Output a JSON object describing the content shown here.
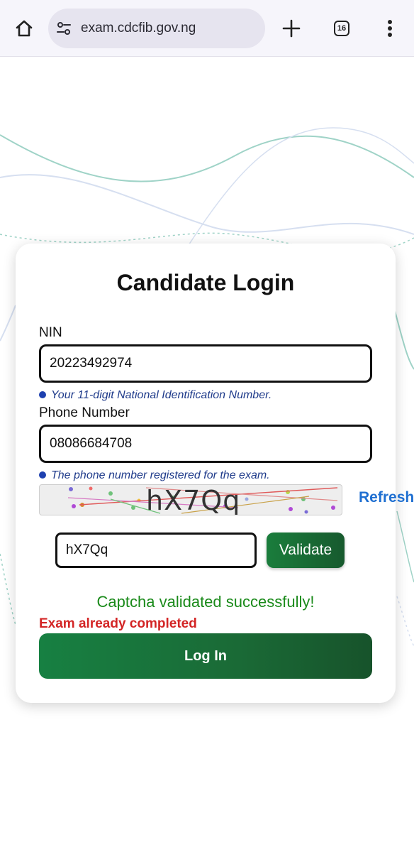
{
  "browser": {
    "url": "exam.cdcfib.gov.ng",
    "tab_count": "16",
    "icons": [
      "home-icon",
      "site-settings-icon",
      "plus-icon",
      "tab-switcher-icon",
      "more-vert-icon"
    ]
  },
  "login": {
    "title": "Candidate Login",
    "nin": {
      "label": "NIN",
      "value": "20223492974",
      "hint": "Your 11-digit National Identification Number."
    },
    "phone": {
      "label": "Phone Number",
      "value": "08086684708",
      "hint": "The phone number registered for the exam."
    },
    "captcha": {
      "image_text": "hX7Qq",
      "refresh_label": "Refresh",
      "input_value": "hX7Qq",
      "validate_label": "Validate"
    },
    "status_success": "Captcha validated successfully!",
    "status_error": "Exam already completed",
    "login_button": "Log In"
  },
  "colors": {
    "brand_green": "#1a7d3c",
    "success_text": "#1a8a1a",
    "error_text": "#d32525",
    "link_blue": "#1f6fd1",
    "hint_blue": "#1e3a8a"
  }
}
